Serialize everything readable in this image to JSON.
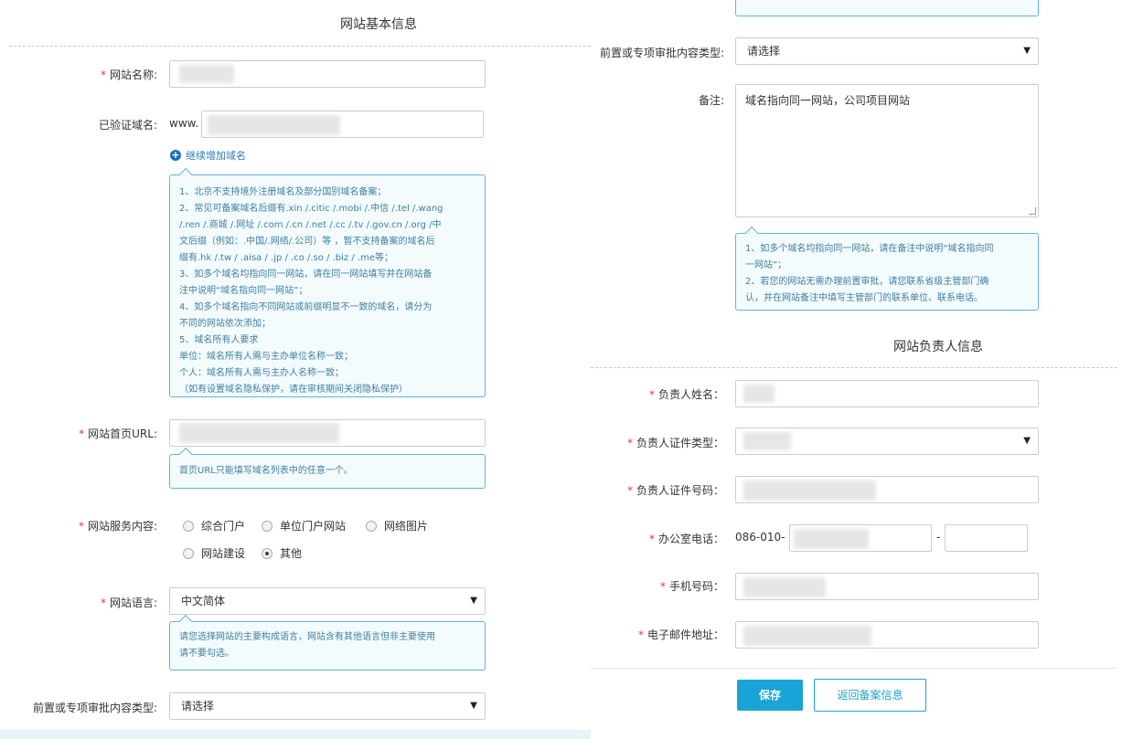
{
  "left": {
    "section_title": "网站基本信息",
    "site_name_label": "网站名称:",
    "verified_domain_label": "已验证域名:",
    "domain_prefix": "www.",
    "add_domain_label": "继续增加域名",
    "domain_tip": [
      "1、北京不支持境外注册域名及部分国别域名备案；",
      "2、常见可备案域名后缀有.xin /.citic /.mobi /.中信 /.tel /.wang",
      "/.ren /.商城 /.网址 /.com /.cn /.net /.cc /.tv /.gov.cn /.org /中",
      "文后缀（例如：.中国/.网络/.公司）等 ，暂不支持备案的域名后",
      "缀有.hk /.tw / .aisa / .jp / .co /.so / .biz / .me等；",
      "3、如多个域名均指向同一网站，请在同一网站填写并在网站备",
      "注中说明“域名指向同一网站”；",
      "4、如多个域名指向不同网站或前缀明显不一致的域名，请分为",
      "不同的网站依次添加；",
      "5、域名所有人要求",
      "单位：域名所有人需与主办单位名称一致；",
      "个人：域名所有人需与主办人名称一致；",
      "（如有设置域名隐私保护，请在审核期间关闭隐私保护）"
    ],
    "homepage_url_label": "网站首页URL:",
    "homepage_url_tip": "首页URL只能填写域名列表中的任意一个。",
    "service_content_label": "网站服务内容:",
    "service_options": [
      "综合门户",
      "单位门户网站",
      "网络图片",
      "网站建设",
      "其他"
    ],
    "language_label": "网站语言:",
    "language_value": "中文简体",
    "language_tip": [
      "请您选择网站的主要构成语言，网站含有其他语言但非主要使用",
      "请不要勾选。"
    ],
    "approval_type_label": "前置或专项审批内容类型:",
    "approval_type_value": "请选择"
  },
  "right": {
    "approval_type_label": "前置或专项审批内容类型:",
    "approval_type_value": "请选择",
    "remark_label": "备注:",
    "remark_value": "域名指向同一网站，公司项目网站",
    "remark_tip": [
      "1、如多个域名均指向同一网站，请在备注中说明“域名指向同",
      "一网站”；",
      "2、若您的网站无需办理前置审批，请您联系省级主管部门确",
      "认，并在网站备注中填写主管部门的联系单位、联系电话。"
    ],
    "section_title": "网站负责人信息",
    "person_name_label": "负责人姓名：",
    "id_type_label": "负责人证件类型：",
    "id_number_label": "负责人证件号码：",
    "office_phone_label": "办公室电话：",
    "office_phone_prefix": "086-010-",
    "phone_separator": "-",
    "mobile_label": "手机号码：",
    "email_label": "电子邮件地址：",
    "save_button": "保存",
    "back_button": "返回备案信息"
  },
  "colors": {
    "accent": "#1aa3d6",
    "required": "#e4393c",
    "tip_border": "#5fb6d8"
  },
  "icons": {
    "add": "plus-circle-icon",
    "dropdown": "caret-down-icon"
  }
}
